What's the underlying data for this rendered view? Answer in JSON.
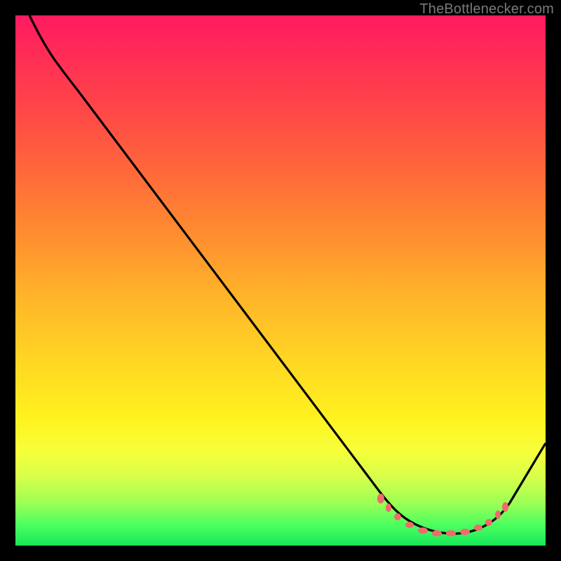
{
  "watermark": {
    "text": "TheBottlenecker.com"
  },
  "chart_data": {
    "type": "line",
    "title": "",
    "xlabel": "",
    "ylabel": "",
    "xlim": [
      0,
      100
    ],
    "ylim": [
      0,
      100
    ],
    "grid": false,
    "legend": false,
    "series": [
      {
        "name": "bottleneck-curve",
        "x": [
          0,
          3,
          6,
          9,
          12,
          72,
          75,
          78,
          81,
          84,
          87,
          90,
          93,
          96,
          100
        ],
        "values": [
          100,
          99,
          97,
          95,
          92,
          5,
          3,
          2,
          2,
          2,
          3,
          6,
          14,
          22,
          32
        ]
      }
    ],
    "marker_band": {
      "name": "optimal-range-dots",
      "x": [
        70,
        72,
        74,
        76,
        78,
        80,
        82,
        84,
        86,
        88,
        90
      ],
      "values": [
        6,
        5,
        4,
        3,
        3,
        3,
        3,
        3,
        4,
        5,
        7
      ]
    },
    "colors": {
      "curve": "#000000",
      "dots": "#ef6b6b",
      "gradient_top": "#ff1a60",
      "gradient_mid": "#fff21e",
      "gradient_bottom": "#15e85a",
      "background": "#000000"
    }
  }
}
